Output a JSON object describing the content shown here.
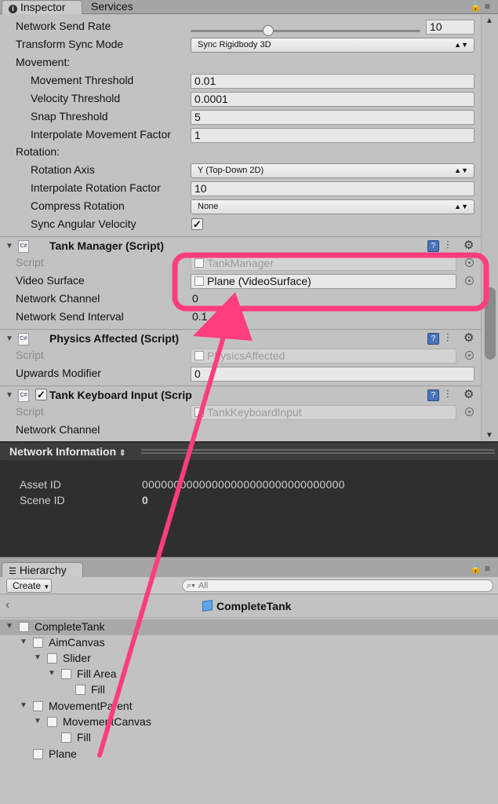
{
  "tabs": {
    "inspector": "Inspector",
    "services": "Services"
  },
  "network_transform": {
    "send_rate_label": "Network Send Rate",
    "send_rate_value": "10",
    "sync_mode_label": "Transform Sync Mode",
    "sync_mode_value": "Sync Rigidbody 3D",
    "movement_label": "Movement:",
    "movement_threshold_label": "Movement Threshold",
    "movement_threshold_value": "0.01",
    "velocity_threshold_label": "Velocity Threshold",
    "velocity_threshold_value": "0.0001",
    "snap_threshold_label": "Snap Threshold",
    "snap_threshold_value": "5",
    "interp_movement_label": "Interpolate Movement Factor",
    "interp_movement_value": "1",
    "rotation_label": "Rotation:",
    "rotation_axis_label": "Rotation Axis",
    "rotation_axis_value": "Y (Top-Down 2D)",
    "interp_rotation_label": "Interpolate Rotation Factor",
    "interp_rotation_value": "10",
    "compress_rotation_label": "Compress Rotation",
    "compress_rotation_value": "None",
    "sync_angular_label": "Sync Angular Velocity",
    "sync_angular_checked": "✓"
  },
  "tank_manager": {
    "title": "Tank Manager (Script)",
    "script_label": "Script",
    "script_value": "TankManager",
    "video_surface_label": "Video Surface",
    "video_surface_value": "Plane (VideoSurface)",
    "network_channel_label": "Network Channel",
    "network_channel_value": "0",
    "send_interval_label": "Network Send Interval",
    "send_interval_value": "0.1"
  },
  "physics_affected": {
    "title": "Physics Affected (Script)",
    "script_label": "Script",
    "script_value": "PhysicsAffected",
    "upwards_label": "Upwards Modifier",
    "upwards_value": "0"
  },
  "tank_keyboard": {
    "title": "Tank Keyboard Input (Scrip",
    "checked": "✓",
    "script_label": "Script",
    "script_value": "TankKeyboardInput",
    "network_channel_label": "Network Channel"
  },
  "network_information": {
    "title": "Network Information",
    "asset_id_label": "Asset ID",
    "asset_id_value": "00000000000000000000000000000000",
    "scene_id_label": "Scene ID",
    "scene_id_value": "0"
  },
  "hierarchy": {
    "tab": "Hierarchy",
    "create_label": "Create",
    "search_placeholder": "All",
    "scene_title": "CompleteTank",
    "items": [
      {
        "name": "CompleteTank"
      },
      {
        "name": "AimCanvas"
      },
      {
        "name": "Slider"
      },
      {
        "name": "Fill Area"
      },
      {
        "name": "Fill"
      },
      {
        "name": "MovementParent"
      },
      {
        "name": "MovementCanvas"
      },
      {
        "name": "Fill"
      },
      {
        "name": "Plane"
      }
    ]
  },
  "colors": {
    "annotation": "#ff3d7f"
  }
}
